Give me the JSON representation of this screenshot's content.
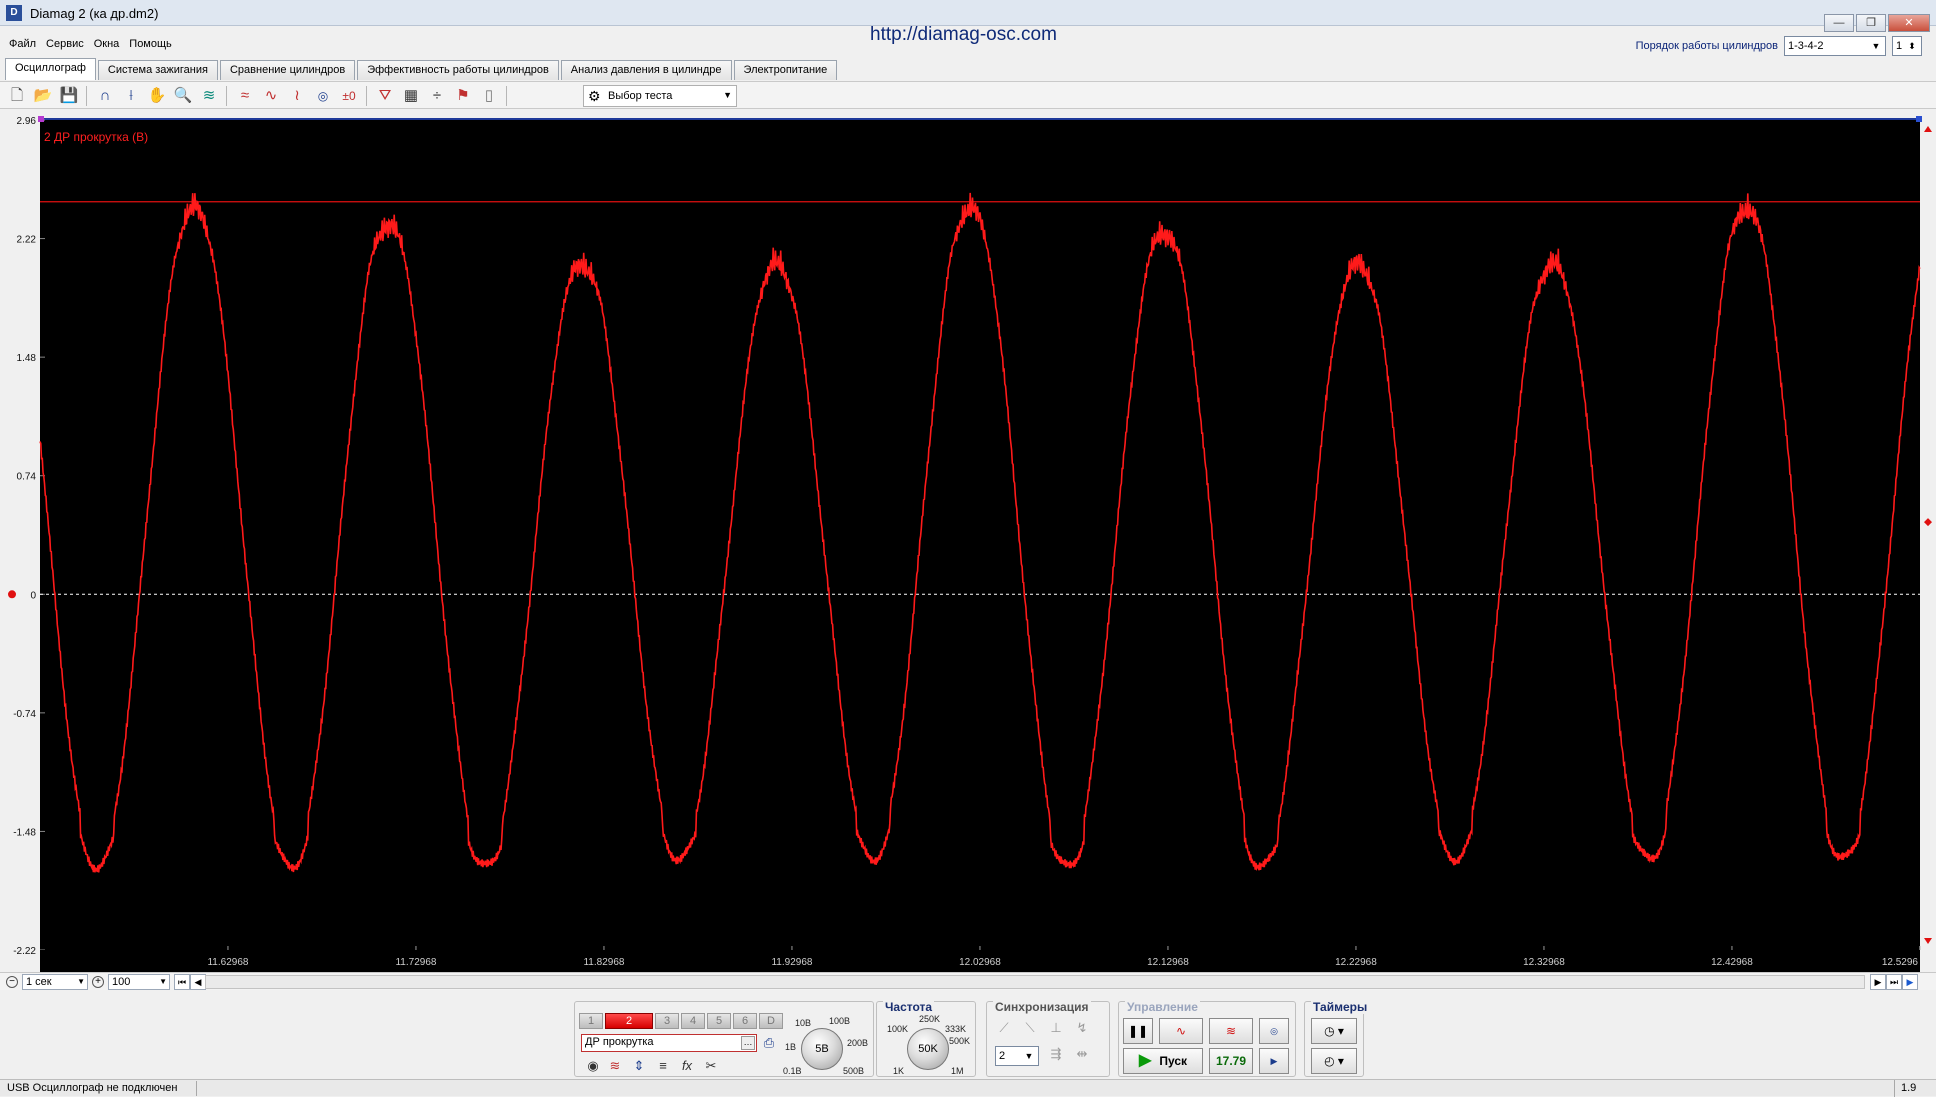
{
  "window": {
    "title": "Diamag 2 (ка др.dm2)",
    "site": "http://diamag-osc.com",
    "min": "—",
    "max": "❐",
    "close": "✕"
  },
  "menu": [
    "Файл",
    "Сервис",
    "Окна",
    "Помощь"
  ],
  "cylinder_order": {
    "label": "Порядок работы цилиндров",
    "value": "1-3-4-2",
    "cylinder": "1"
  },
  "tabs": [
    "Осциллограф",
    "Система зажигания",
    "Сравнение цилиндров",
    "Эффективность работы цилиндров",
    "Анализ давления в цилиндре",
    "Электропитание"
  ],
  "toolbar": {
    "test_select": "Выбор теста"
  },
  "colors": {
    "trace": "#ff1a1a",
    "plot_bg": "#000000",
    "grid": "#3a3a3a"
  },
  "chart_data": {
    "type": "line",
    "title": "2 ДР прокрутка (В)",
    "xlabel": "",
    "ylabel": "",
    "xlim": [
      11.5297,
      12.5297
    ],
    "ylim": [
      -2.22,
      2.96
    ],
    "yticks": [
      "2.96",
      "2.22",
      "1.48",
      "0.74",
      "0",
      "-0.74",
      "-1.48",
      "-2.22"
    ],
    "xticks": [
      "11.62968",
      "11.72968",
      "11.82968",
      "11.92968",
      "12.02968",
      "12.12968",
      "12.22968",
      "12.32968",
      "12.42968",
      "12.5296"
    ],
    "trigger_level": 2.45,
    "zero_line": 0,
    "series": [
      {
        "period": 0.1032,
        "first_peak_time": 11.6117,
        "peaks": [
          2.5,
          2.4,
          2.15,
          2.15,
          2.5,
          2.35,
          2.15,
          2.15,
          2.5
        ],
        "troughs": [
          -1.7,
          -1.7,
          -1.7,
          -1.65,
          -1.65,
          -1.7,
          -1.7,
          -1.65,
          -1.65,
          -1.65
        ],
        "points": [
          [
            11.5297,
            0.35
          ],
          [
            11.54,
            -0.55
          ],
          [
            11.555,
            -1.35
          ],
          [
            11.565,
            -1.7
          ],
          [
            11.585,
            -1.3
          ],
          [
            11.596,
            0.0
          ],
          [
            11.607,
            1.6
          ],
          [
            11.6117,
            2.5
          ],
          [
            11.625,
            1.8
          ],
          [
            11.64,
            0.0
          ],
          [
            11.66,
            -1.55
          ],
          [
            11.669,
            -1.7
          ],
          [
            11.685,
            -1.2
          ],
          [
            11.695,
            0.0
          ],
          [
            11.706,
            1.55
          ],
          [
            11.7149,
            2.4
          ],
          [
            11.73,
            1.7
          ],
          [
            11.745,
            0.0
          ],
          [
            11.765,
            -1.5
          ],
          [
            11.772,
            -1.7
          ],
          [
            11.788,
            -1.2
          ],
          [
            11.798,
            0.0
          ],
          [
            11.808,
            1.4
          ],
          [
            11.8181,
            2.15
          ],
          [
            11.833,
            1.6
          ],
          [
            11.848,
            0.0
          ],
          [
            11.868,
            -1.5
          ],
          [
            11.8752,
            -1.7
          ],
          [
            11.891,
            -1.2
          ],
          [
            11.901,
            0.0
          ],
          [
            11.911,
            1.4
          ],
          [
            11.9213,
            2.15
          ],
          [
            11.936,
            1.6
          ],
          [
            11.951,
            0.0
          ],
          [
            11.971,
            -1.5
          ],
          [
            11.9784,
            -1.65
          ],
          [
            11.994,
            -1.2
          ],
          [
            12.004,
            0.0
          ],
          [
            12.015,
            1.6
          ],
          [
            12.0245,
            2.5
          ],
          [
            12.039,
            1.8
          ],
          [
            12.054,
            0.0
          ],
          [
            12.074,
            -1.5
          ],
          [
            12.0816,
            -1.65
          ],
          [
            12.097,
            -1.2
          ],
          [
            12.107,
            0.0
          ],
          [
            12.118,
            1.55
          ],
          [
            12.1277,
            2.35
          ],
          [
            12.142,
            1.7
          ],
          [
            12.157,
            0.0
          ],
          [
            12.177,
            -1.5
          ],
          [
            12.1848,
            -1.7
          ],
          [
            12.2,
            -1.2
          ],
          [
            12.21,
            0.0
          ],
          [
            12.22,
            1.4
          ],
          [
            12.2309,
            2.15
          ],
          [
            12.245,
            1.6
          ],
          [
            12.26,
            0.0
          ],
          [
            12.28,
            -1.5
          ],
          [
            12.288,
            -1.7
          ],
          [
            12.303,
            -1.2
          ],
          [
            12.313,
            0.0
          ],
          [
            12.323,
            1.4
          ],
          [
            12.3341,
            2.15
          ],
          [
            12.348,
            1.6
          ],
          [
            12.363,
            0.0
          ],
          [
            12.383,
            -1.5
          ],
          [
            12.3912,
            -1.65
          ],
          [
            12.406,
            -1.2
          ],
          [
            12.416,
            0.0
          ],
          [
            12.427,
            1.6
          ],
          [
            12.4373,
            2.5
          ],
          [
            12.451,
            1.8
          ],
          [
            12.466,
            0.0
          ],
          [
            12.486,
            -1.5
          ],
          [
            12.4944,
            -1.65
          ],
          [
            12.505,
            -1.4
          ],
          [
            12.5297,
            -1.3
          ]
        ]
      }
    ]
  },
  "nav": {
    "timebase": "1 сек",
    "zoom": "100"
  },
  "channels": {
    "buttons": [
      "1",
      "2",
      "3",
      "4",
      "5",
      "6",
      "D"
    ],
    "active": "2",
    "name": "ДР прокрутка"
  },
  "voltage_knob": {
    "value": "5В",
    "labels": [
      "10В",
      "100В",
      "1В",
      "200В",
      "0.1В",
      "500В"
    ]
  },
  "frequency": {
    "title": "Частота",
    "value": "50K",
    "labels": [
      "250K",
      "100K",
      "333K",
      "500K",
      "1K",
      "1M"
    ]
  },
  "sync": {
    "title": "Синхронизация",
    "channel": "2"
  },
  "control": {
    "title": "Управление",
    "start": "Пуск",
    "rate": "17.79"
  },
  "timers": {
    "title": "Таймеры"
  },
  "status": {
    "left": "USB Осциллограф не подключен",
    "right": "1.9"
  }
}
